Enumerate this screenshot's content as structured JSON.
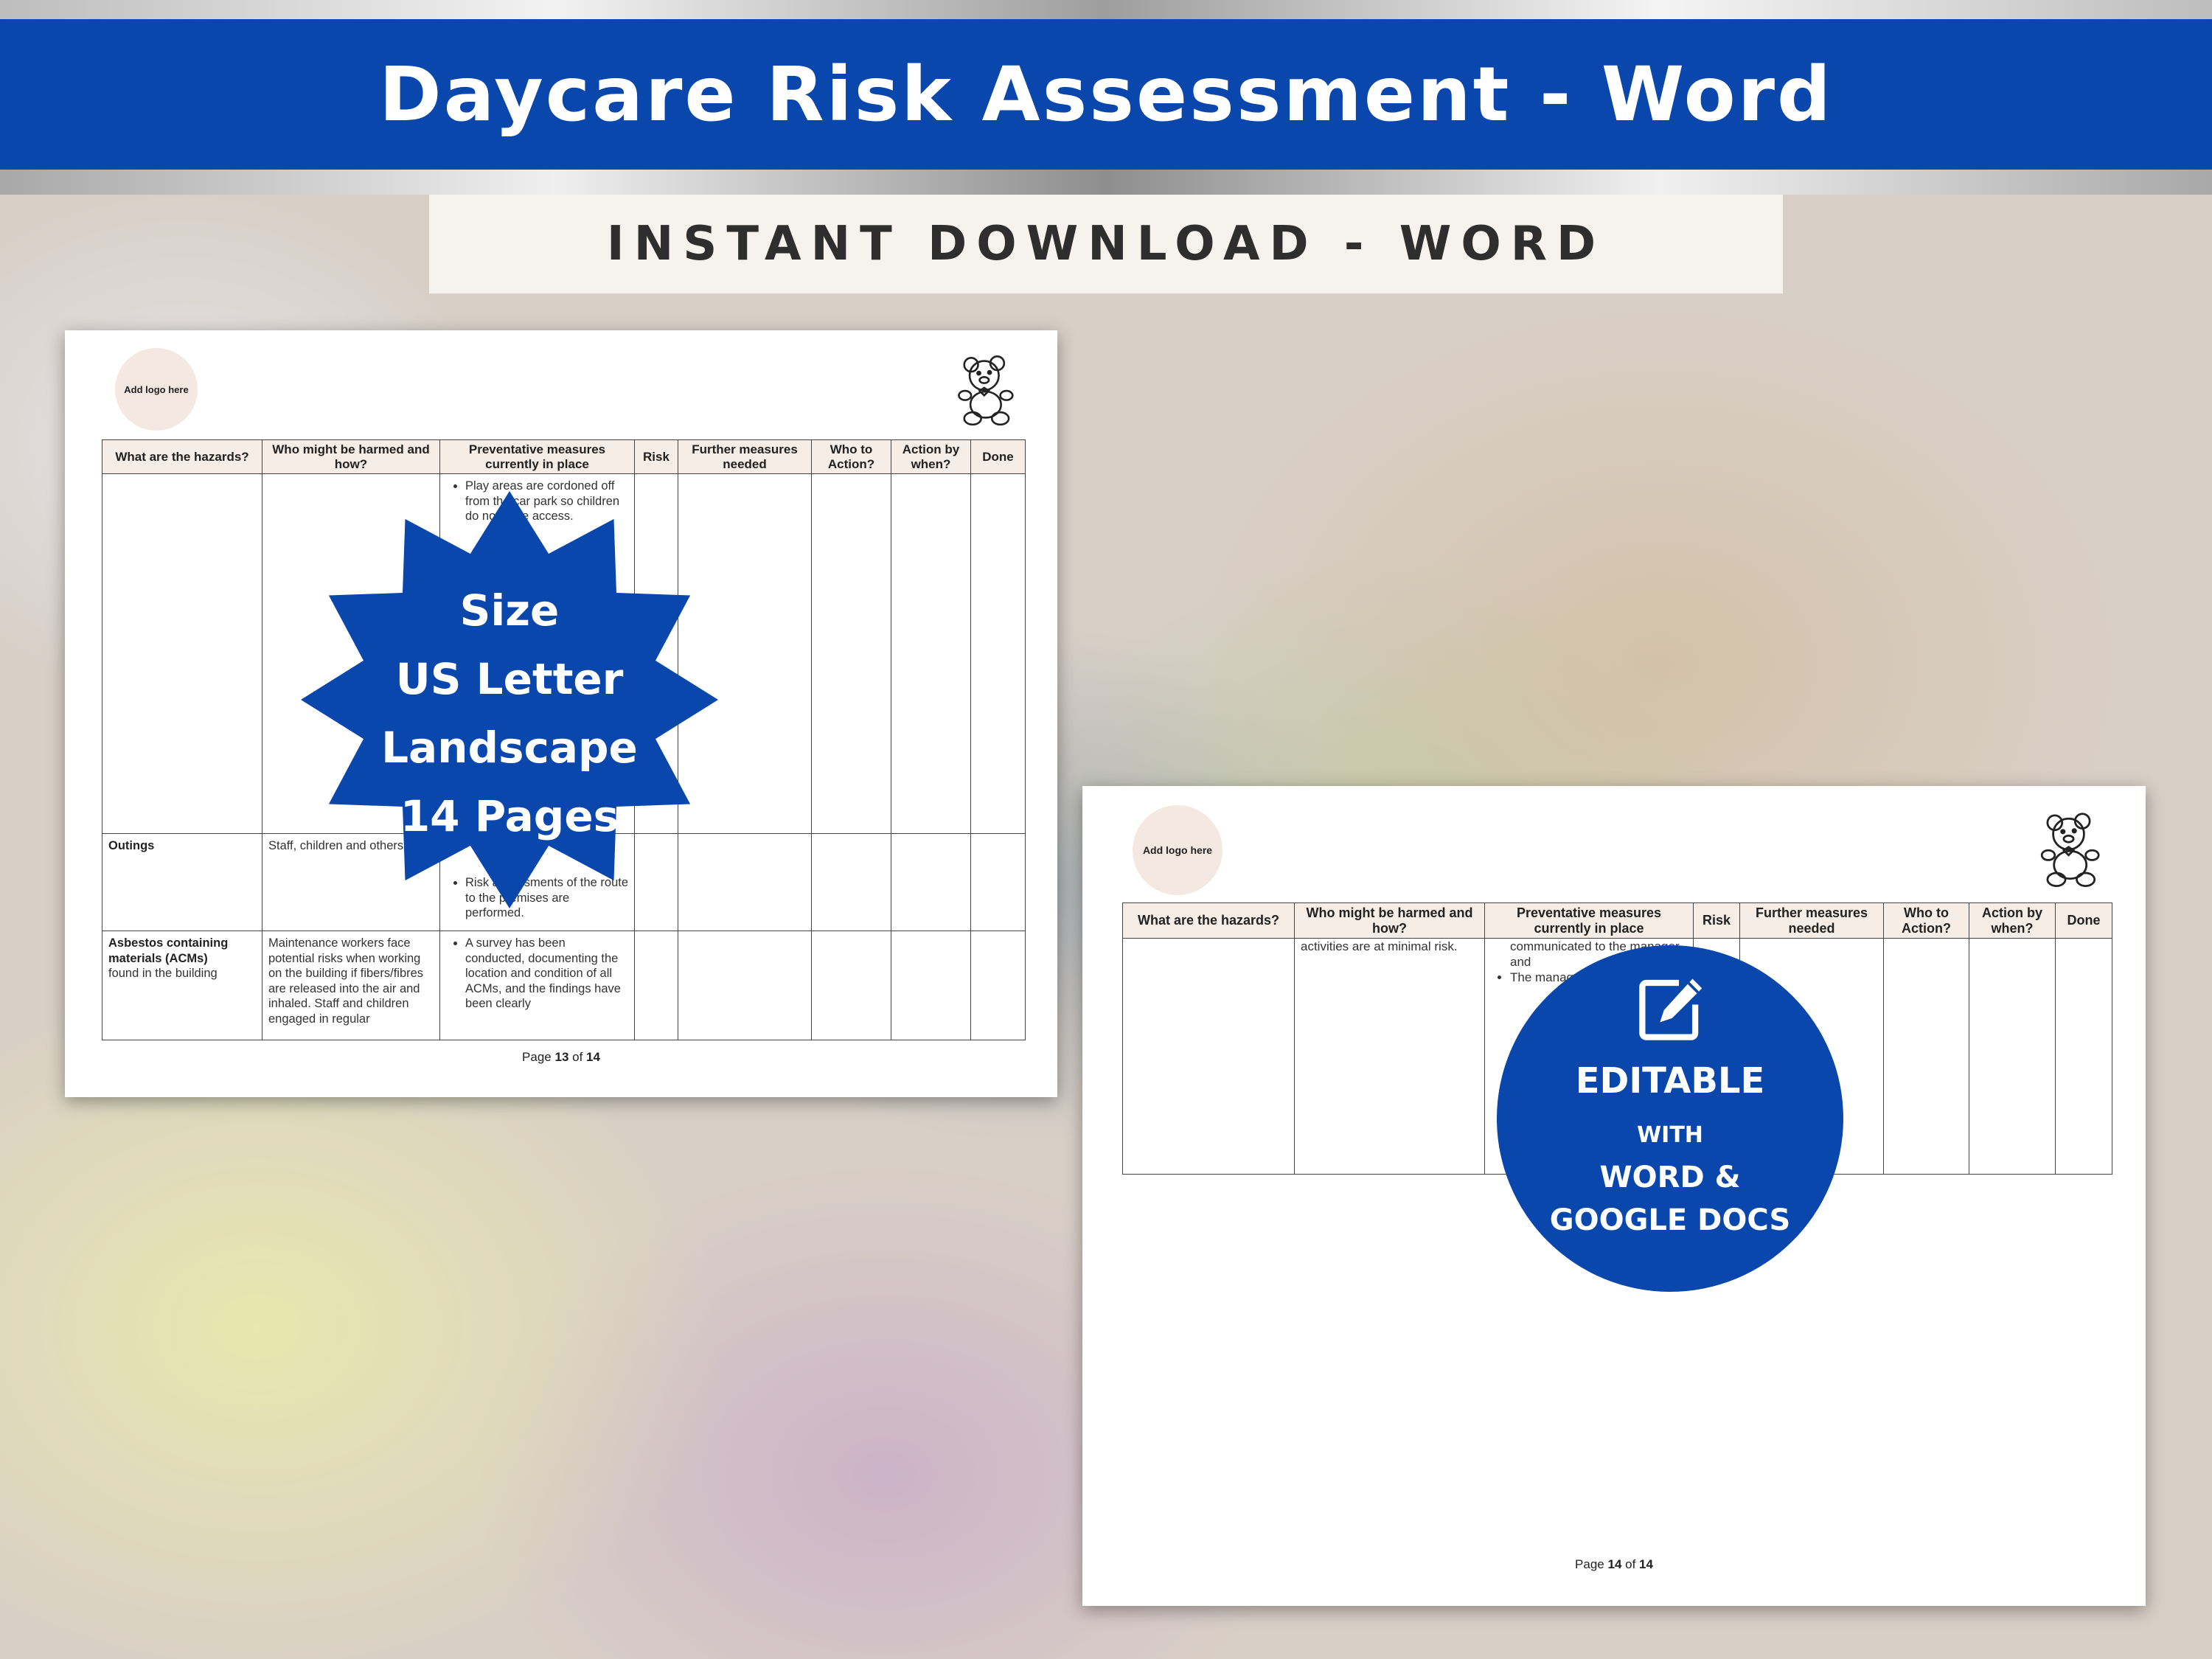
{
  "banner": {
    "title": "Daycare Risk Assessment - Word"
  },
  "subtitle": "INSTANT DOWNLOAD - WORD",
  "logo_placeholder": "Add logo here",
  "headers": [
    "What are the hazards?",
    "Who might be harmed and how?",
    "Preventative measures currently in place",
    "Risk",
    "Further measures needed",
    "Who to Action?",
    "Action by when?",
    "Done"
  ],
  "page1": {
    "rows": [
      {
        "hazard": "",
        "who": "",
        "measures": [
          "Play areas are cordoned off from the car park so children do not have access."
        ]
      },
      {
        "hazard": "Outings",
        "who": "Staff, children and others",
        "measures": [
          "Risk assessments of the route to the premises are performed."
        ]
      },
      {
        "hazard": "Asbestos containing materials (ACMs)",
        "hazard_extra": "found in the building",
        "who": "Maintenance workers face potential risks when working on the building if fibers/fibres are released into the air and inhaled. Staff and children engaged in regular",
        "measures": [
          "A survey has been conducted, documenting the location and condition of all ACMs, and the findings have been clearly"
        ]
      }
    ],
    "footer": {
      "prefix": "Page ",
      "current": "13",
      "middle": " of ",
      "total": "14"
    }
  },
  "page2": {
    "rows": [
      {
        "hazard": "",
        "who": "activities are at minimal risk.",
        "measures_top": "communicated to the manager and",
        "measures": [
          "The manager trained"
        ]
      }
    ],
    "footer": {
      "prefix": "Page ",
      "current": "14",
      "middle": " of ",
      "total": "14"
    }
  },
  "star_badge": {
    "lines": [
      "Size",
      "US Letter",
      "Landscape",
      "14 Pages"
    ],
    "color": "#0a47ad"
  },
  "circle_badge": {
    "icon": "edit-icon",
    "line1": "EDITABLE",
    "line2": "WITH",
    "line3": "WORD &",
    "line4": "GOOGLE DOCS",
    "color": "#0a47ad"
  }
}
